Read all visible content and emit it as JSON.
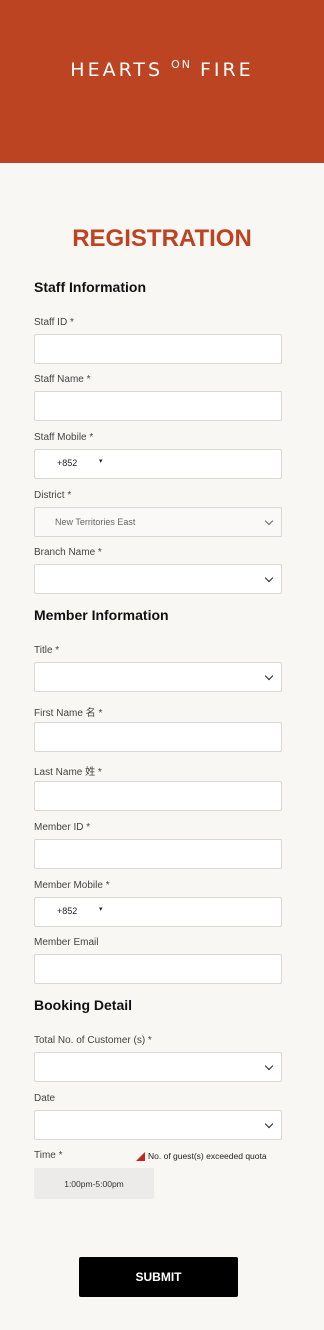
{
  "brand": {
    "logo_part1": "HEARTS",
    "logo_part2": "ON",
    "logo_part3": "FIRE"
  },
  "page_title": "REGISTRATION",
  "staff": {
    "section_title": "Staff Information",
    "staff_id_label": "Staff ID *",
    "staff_name_label": "Staff Name *",
    "staff_mobile_label": "Staff Mobile *",
    "staff_mobile_code": "+852",
    "district_label": "District *",
    "district_value": "New Territories East",
    "branch_label": "Branch Name *"
  },
  "member": {
    "section_title": "Member Information",
    "title_label": "Title *",
    "first_name_label": "First Name 名 *",
    "last_name_label": "Last Name 姓 *",
    "member_id_label": "Member ID *",
    "member_mobile_label": "Member Mobile *",
    "member_mobile_code": "+852",
    "member_email_label": "Member Email"
  },
  "booking": {
    "section_title": "Booking Detail",
    "customers_label": "Total No. of Customer (s) *",
    "date_label": "Date",
    "time_label": "Time *",
    "quota_warning": "No. of guest(s) exceeded quota",
    "time_slot": "1:00pm-5:00pm"
  },
  "submit_label": "SUBMIT",
  "colors": {
    "brand": "#bd4422",
    "background": "#f9f7f3",
    "warning": "#c8261c"
  },
  "icons": {
    "select": "chevron-down-icon",
    "phone_dropdown": "caret-down-icon",
    "warning": "warning-triangle-icon"
  }
}
